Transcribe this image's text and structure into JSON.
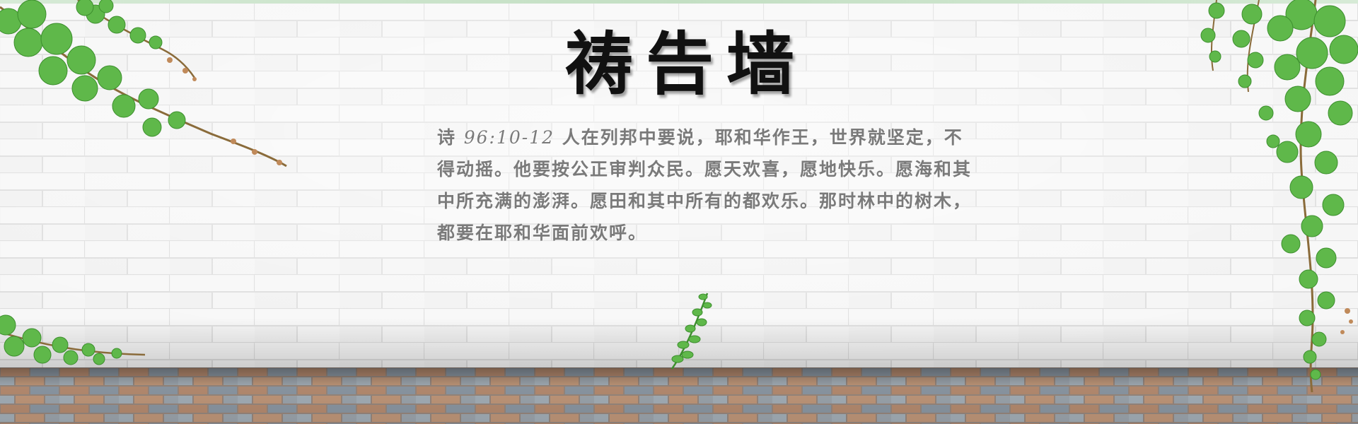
{
  "page": {
    "title": "祷告墙",
    "verse": {
      "book": "诗",
      "reference": "96:10-12",
      "text": "人在列邦中要说，耶和华作王，世界就坚定，不得动摇。他要按公正审判众民。愿天欢喜，愿地快乐。愿海和其中所充满的澎湃。愿田和其中所有的都欢乐。那时林中的树木，都要在耶和华面前欢呼。"
    }
  },
  "colors": {
    "title": "#111111",
    "verse_text": "#7a7a7a",
    "wall": "#f2f2f2",
    "mortar": "#dcdcdc",
    "leaf": "#5fb84a",
    "leaf_dark": "#3d8f2e",
    "stem": "#8a6b3a",
    "floor_brick": "#b98e72",
    "floor_brick_alt": "#8e9aa6"
  },
  "icons": [
    "vine-decoration",
    "brick-wall-background",
    "paved-floor"
  ]
}
